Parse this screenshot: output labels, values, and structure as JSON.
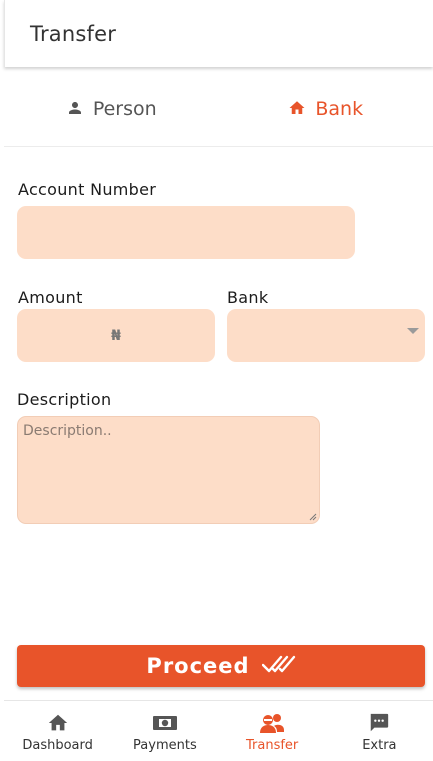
{
  "header": {
    "title": "Transfer"
  },
  "tabs": [
    {
      "label": "Person",
      "icon": "person-icon",
      "active": false
    },
    {
      "label": "Bank",
      "icon": "home-icon",
      "active": true
    }
  ],
  "form": {
    "account_number": {
      "label": "Account Number",
      "value": ""
    },
    "amount": {
      "label": "Amount",
      "value": "",
      "currency_symbol": "₦"
    },
    "bank": {
      "label": "Bank",
      "selected": ""
    },
    "description": {
      "label": "Description",
      "placeholder": "Description..",
      "value": ""
    }
  },
  "proceed": {
    "label": "Proceed",
    "icon": "double-check-icon"
  },
  "bottom_nav": [
    {
      "label": "Dashboard",
      "icon": "home-icon",
      "active": false
    },
    {
      "label": "Payments",
      "icon": "money-icon",
      "active": false
    },
    {
      "label": "Transfer",
      "icon": "users-transfer-icon",
      "active": true
    },
    {
      "label": "Extra",
      "icon": "chat-icon",
      "active": false
    }
  ],
  "colors": {
    "accent": "#e8542a",
    "field_bg": "#fdddc8"
  }
}
